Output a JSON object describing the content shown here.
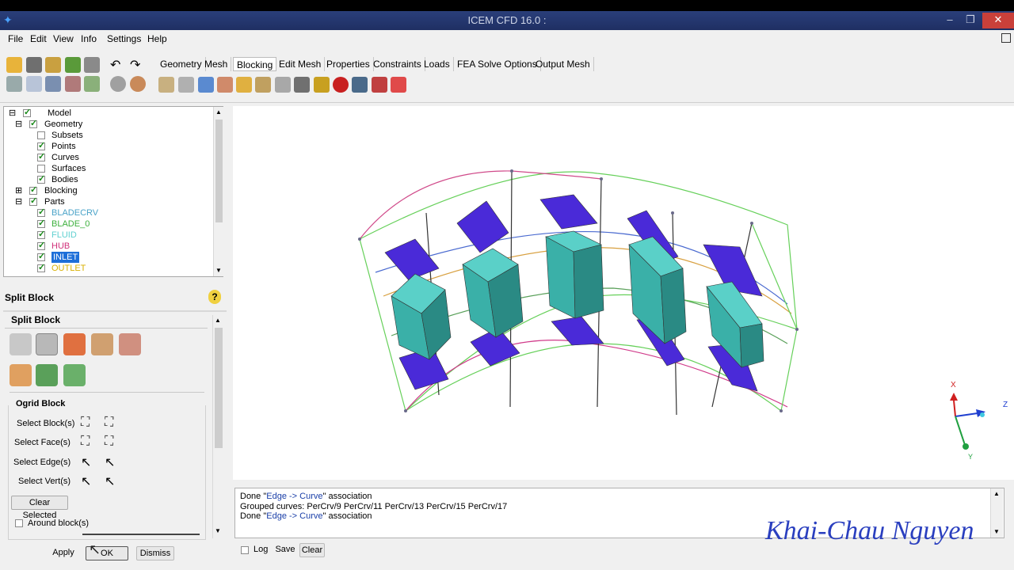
{
  "window": {
    "title": "ICEM CFD 16.0 :"
  },
  "menu": [
    "File",
    "Edit",
    "View",
    "Info",
    "Settings",
    "Help"
  ],
  "tabs": [
    "Geometry",
    "Mesh",
    "Blocking",
    "Edit Mesh",
    "Properties",
    "Constraints",
    "Loads",
    "FEA Solve Options",
    "Output Mesh"
  ],
  "active_tab": "Blocking",
  "tree": {
    "model": "Model",
    "geometry": "Geometry",
    "subsets": "Subsets",
    "points": "Points",
    "curves": "Curves",
    "surfaces": "Surfaces",
    "bodies": "Bodies",
    "blocking": "Blocking",
    "parts": "Parts",
    "part_items": [
      {
        "label": "BLADECRV",
        "color": "#4aa3c8"
      },
      {
        "label": "BLADE_0",
        "color": "#3db03d"
      },
      {
        "label": "FLUID",
        "color": "#5fd0d0"
      },
      {
        "label": "HUB",
        "color": "#d0307a"
      },
      {
        "label": "INLET",
        "color": "#ffffff",
        "selected": true
      },
      {
        "label": "OUTLET",
        "color": "#d8b000"
      }
    ]
  },
  "panel": {
    "title": "Split Block",
    "help_icon": "question-icon",
    "section": "Split Block",
    "ogrid": "Ogrid Block",
    "select_block": "Select Block(s)",
    "select_face": "Select Face(s)",
    "select_edge": "Select Edge(s)",
    "select_vert": "Select Vert(s)",
    "clear_selected": "Clear Selected",
    "around_blocks": "Around block(s)",
    "apply": "Apply",
    "ok": "OK",
    "dismiss": "Dismiss"
  },
  "console": {
    "line1_a": "Done \"",
    "line1_b": "Edge -> Curve",
    "line1_c": "\" association",
    "line2": "Grouped curves: PerCrv/9 PerCrv/11 PerCrv/13 PerCrv/15 PerCrv/17",
    "line3_a": "Done \"",
    "line3_b": "Edge -> Curve",
    "line3_c": "\" association",
    "log": "Log",
    "save": "Save",
    "clear": "Clear"
  },
  "axes": {
    "x": "X",
    "y": "Y",
    "z": "Z"
  },
  "watermark": "Khai-Chau Nguyen"
}
